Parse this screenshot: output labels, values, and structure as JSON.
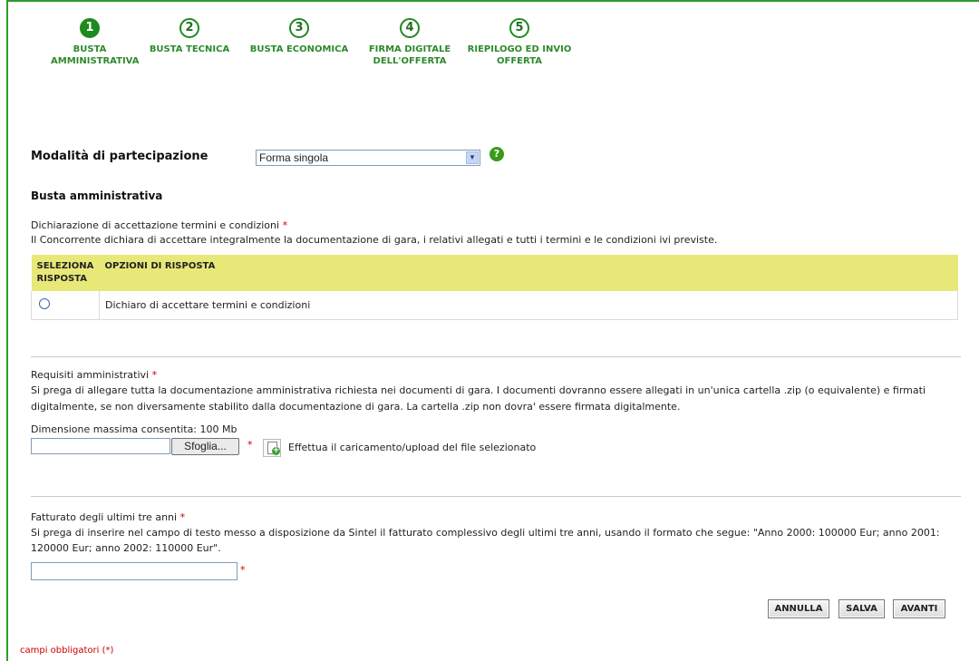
{
  "steps": [
    {
      "number": "1",
      "label_line1": "BUSTA",
      "label_line2": "AMMINISTRATIVA",
      "active": true
    },
    {
      "number": "2",
      "label_line1": "BUSTA TECNICA",
      "label_line2": ""
    },
    {
      "number": "3",
      "label_line1": "BUSTA ECONOMICA",
      "label_line2": ""
    },
    {
      "number": "4",
      "label_line1": "FIRMA DIGITALE",
      "label_line2": "DELL'OFFERTA"
    },
    {
      "number": "5",
      "label_line1": "RIEPILOGO ED INVIO",
      "label_line2": "OFFERTA"
    }
  ],
  "participation": {
    "label": "Modalità di partecipazione",
    "selected": "Forma singola",
    "help_glyph": "?"
  },
  "section_title": "Busta amministrativa",
  "declaration": {
    "title": "Dichiarazione di accettazione termini e condizioni",
    "required_mark": "*",
    "description": "Il Concorrente dichiara di accettare integralmente la documentazione di gara, i relativi allegati e tutti i termini e le condizioni ivi previste.",
    "table_headers": [
      "SELEZIONA RISPOSTA",
      "OPZIONI DI RISPOSTA"
    ],
    "option": "Dichiaro di accettare termini e condizioni"
  },
  "requirements": {
    "title": "Requisiti amministrativi",
    "required_mark": "*",
    "description_line1": "Si prega di allegare tutta la documentazione amministrativa richiesta nei documenti di gara. I documenti dovranno essere allegati in un'unica cartella .zip (o equivalente) e firmati",
    "description_line2": "digitalmente, se non diversamente stabilito dalla documentazione di gara. La cartella .zip non dovra' essere firmata digitalmente.",
    "max_size": "Dimensione massima consentita: 100 Mb",
    "browse_label": "Sfoglia...",
    "upload_label": "Effettua il caricamento/upload del file selezionato"
  },
  "revenue": {
    "title": "Fatturato degli ultimi tre anni",
    "required_mark": "*",
    "description_line1": "Si prega di inserire nel campo di testo messo a disposizione da Sintel il fatturato complessivo degli ultimi tre anni, usando il formato che segue: \"Anno 2000: 100000 Eur; anno 2001:",
    "description_line2": "120000 Eur; anno 2002: 110000 Eur\"."
  },
  "buttons": {
    "cancel": "ANNULLA",
    "save": "SALVA",
    "next": "AVANTI"
  },
  "footer_note": "campi obbligatori (*)",
  "colors": {
    "accent_green": "#2e9b2e",
    "table_header": "#e8e878",
    "required_red": "#cc0000"
  }
}
